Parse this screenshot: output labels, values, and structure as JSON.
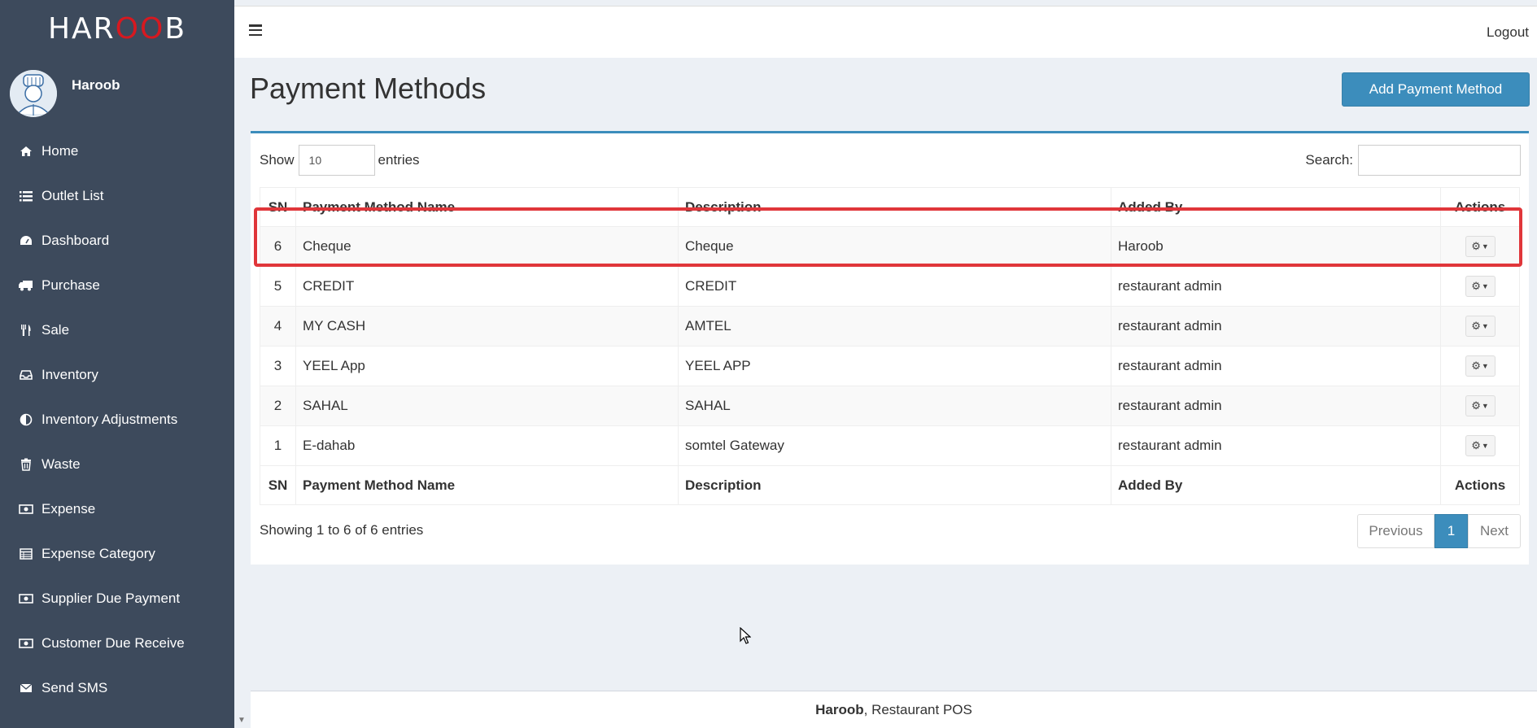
{
  "app": {
    "logo_left": "HAR",
    "logo_mid": "OO",
    "logo_right": "B",
    "user_name": "Haroob",
    "logout": "Logout",
    "colors": {
      "sidebar": "#3d4a5c",
      "accent": "#3c8dbc",
      "highlight": "#e0363a",
      "logo_red": "#d71920"
    }
  },
  "sidebar": {
    "items": [
      {
        "label": "Home",
        "icon": "home-icon"
      },
      {
        "label": "Outlet List",
        "icon": "list-icon"
      },
      {
        "label": "Dashboard",
        "icon": "dashboard-icon"
      },
      {
        "label": "Purchase",
        "icon": "truck-icon"
      },
      {
        "label": "Sale",
        "icon": "cutlery-icon"
      },
      {
        "label": "Inventory",
        "icon": "inbox-icon"
      },
      {
        "label": "Inventory Adjustments",
        "icon": "adjust-icon"
      },
      {
        "label": "Waste",
        "icon": "trash-icon"
      },
      {
        "label": "Expense",
        "icon": "money-icon"
      },
      {
        "label": "Expense Category",
        "icon": "table-icon"
      },
      {
        "label": "Supplier Due Payment",
        "icon": "money-icon"
      },
      {
        "label": "Customer Due Receive",
        "icon": "money-icon"
      },
      {
        "label": "Send SMS",
        "icon": "envelope-icon"
      }
    ]
  },
  "page": {
    "title": "Payment Methods",
    "add_button": "Add Payment Method",
    "show_label": "Show",
    "entries_value": "10",
    "entries_label": "entries",
    "search_label": "Search:",
    "search_value": ""
  },
  "table": {
    "headers": {
      "sn": "SN",
      "name": "Payment Method Name",
      "description": "Description",
      "added_by": "Added By",
      "actions": "Actions"
    },
    "rows": [
      {
        "sn": "6",
        "name": "Cheque",
        "description": "Cheque",
        "added_by": "Haroob"
      },
      {
        "sn": "5",
        "name": "CREDIT",
        "description": "CREDIT",
        "added_by": "restaurant admin"
      },
      {
        "sn": "4",
        "name": "MY CASH",
        "description": "AMTEL",
        "added_by": "restaurant admin"
      },
      {
        "sn": "3",
        "name": "YEEL App",
        "description": "YEEL APP",
        "added_by": "restaurant admin"
      },
      {
        "sn": "2",
        "name": "SAHAL",
        "description": "SAHAL",
        "added_by": "restaurant admin"
      },
      {
        "sn": "1",
        "name": "E-dahab",
        "description": "somtel Gateway",
        "added_by": "restaurant admin"
      }
    ],
    "info": "Showing 1 to 6 of 6 entries",
    "pagination": {
      "previous": "Previous",
      "current": "1",
      "next": "Next"
    }
  },
  "footer": {
    "brand": "Haroob",
    "suffix": ", Restaurant POS"
  }
}
